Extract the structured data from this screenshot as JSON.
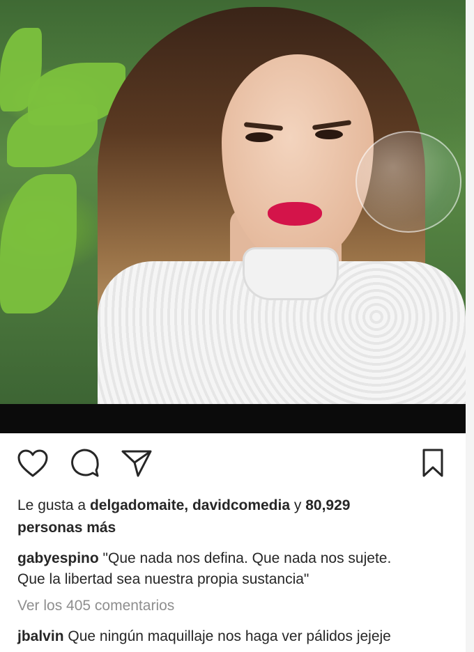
{
  "post": {
    "likes": {
      "prefix": "Le gusta a",
      "users": "delgadomaite, davidcomedia",
      "connector": "y",
      "count": "80,929",
      "suffix": "personas más"
    },
    "caption": {
      "username": "gabyespino",
      "line1": "\"Que nada nos defina. Que nada nos sujete.",
      "line2": "Que la libertad sea nuestra propia sustancia\""
    },
    "view_comments": "Ver los 405 comentarios",
    "comment": {
      "username": "jbalvin",
      "text": "Que ningún maquillaje nos haga ver pálidos jejeje"
    }
  },
  "icons": {
    "like": "heart-icon",
    "comment": "comment-bubble-icon",
    "share": "paper-plane-icon",
    "save": "bookmark-icon"
  }
}
